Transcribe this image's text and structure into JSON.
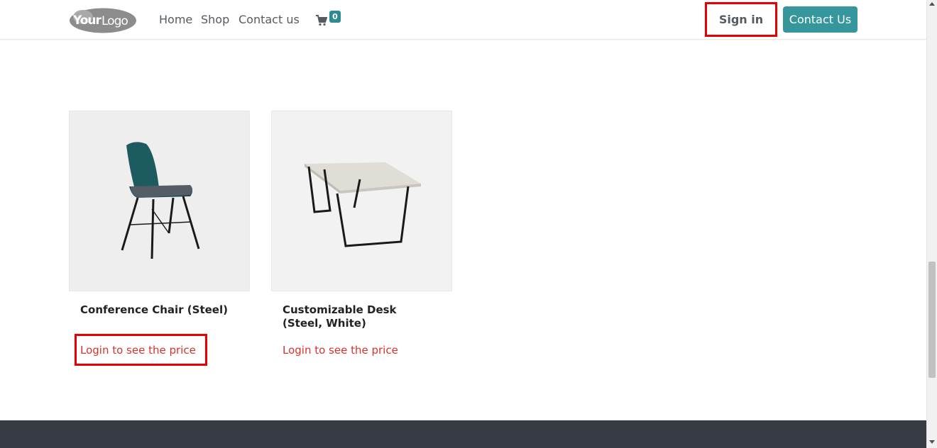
{
  "header": {
    "logo_text": "YourLogo",
    "nav": [
      {
        "label": "Home"
      },
      {
        "label": "Shop"
      },
      {
        "label": "Contact us"
      }
    ],
    "cart_count": "0",
    "sign_in_label": "Sign in",
    "contact_button_label": "Contact Us"
  },
  "products": [
    {
      "name": "Conference Chair (Steel)",
      "price_text": "Login to see the price"
    },
    {
      "name": "Customizable Desk (Steel, White)",
      "price_text": "Login to see the price"
    }
  ],
  "colors": {
    "accent": "#35979c",
    "highlight": "#e60000",
    "price_text": "#d9322a",
    "footer": "#373c44"
  }
}
